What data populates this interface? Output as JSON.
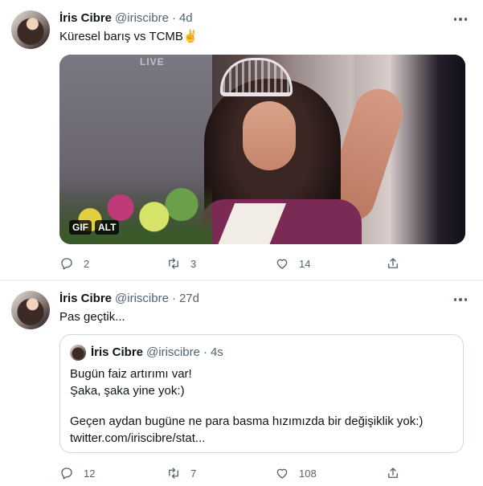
{
  "colors": {
    "text_primary": "#0f1419",
    "text_secondary": "#536471",
    "border": "#cfd9de",
    "divider": "#eff3f4"
  },
  "tweets": [
    {
      "name": "İris Cibre",
      "handle": "@iriscibre",
      "separator": "·",
      "time": "4d",
      "text": "Küresel barış vs TCMB✌️",
      "media": {
        "overlay_text": "LIVE",
        "badges": [
          "GIF",
          "ALT"
        ]
      },
      "actions": {
        "replies": "2",
        "retweets": "3",
        "likes": "14",
        "reply_icon": "reply-icon",
        "retweet_icon": "retweet-icon",
        "like_icon": "heart-icon",
        "share_icon": "share-icon"
      }
    },
    {
      "name": "İris Cibre",
      "handle": "@iriscibre",
      "separator": "·",
      "time": "27d",
      "text": "Pas geçtik...",
      "quote": {
        "name": "İris Cibre",
        "handle": "@iriscibre",
        "separator": "·",
        "time": "4s",
        "lines": [
          "Bugün faiz artırımı var!",
          "Şaka, şaka yine yok:)",
          "Geçen aydan bugüne ne para basma hızımızda bir değişiklik yok:)",
          "twitter.com/iriscibre/stat..."
        ]
      },
      "actions": {
        "replies": "12",
        "retweets": "7",
        "likes": "108",
        "reply_icon": "reply-icon",
        "retweet_icon": "retweet-icon",
        "like_icon": "heart-icon",
        "share_icon": "share-icon"
      }
    }
  ]
}
